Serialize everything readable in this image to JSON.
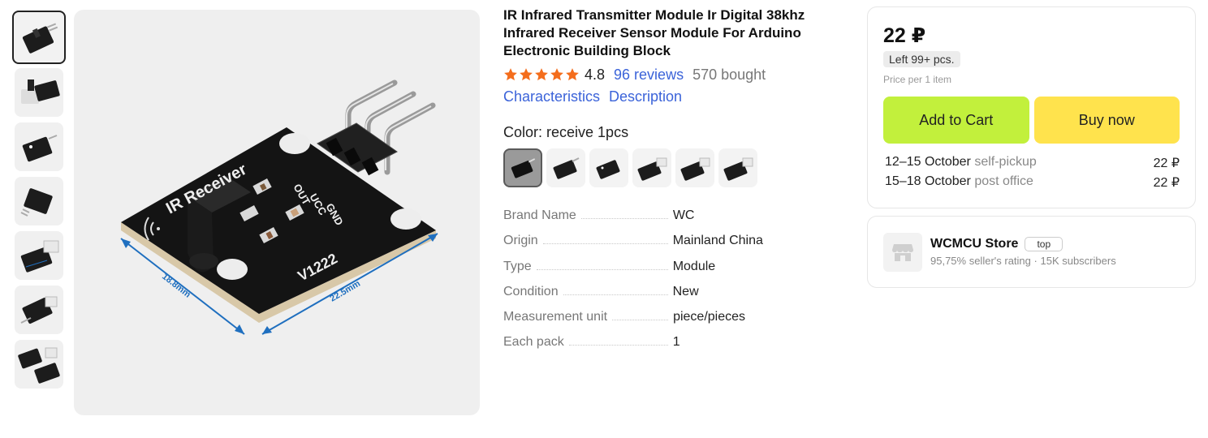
{
  "gallery": {
    "thumbnails": [
      "thumb-1",
      "thumb-2",
      "thumb-3",
      "thumb-4",
      "thumb-5",
      "thumb-6",
      "thumb-7"
    ],
    "selected_index": 0,
    "main_image": {
      "board_labels": [
        "IR Receiver",
        "OUT",
        "UCC",
        "GND",
        "V1222"
      ],
      "dimension_width": "18.8mm",
      "dimension_length": "22.5mm"
    }
  },
  "product": {
    "title": "IR Infrared Transmitter Module Ir Digital 38khz Infrared Receiver Sensor Module For Arduino Electronic Building Block",
    "rating": "4.8",
    "stars": 5,
    "reviews": "96 reviews",
    "bought": "570 bought",
    "links": {
      "characteristics": "Characteristics",
      "description": "Description"
    },
    "color_label": "Color: receive 1pcs",
    "swatch_count": 6,
    "specs": [
      {
        "key": "Brand Name",
        "value": "WC"
      },
      {
        "key": "Origin",
        "value": "Mainland China"
      },
      {
        "key": "Type",
        "value": "Module"
      },
      {
        "key": "Condition",
        "value": "New"
      },
      {
        "key": "Measurement unit",
        "value": "piece/pieces"
      },
      {
        "key": "Each pack",
        "value": "1"
      }
    ]
  },
  "buy_box": {
    "price": "22 ₽",
    "stock": "Left 99+ pcs.",
    "price_note": "Price per 1 item",
    "add_to_cart": "Add to Cart",
    "buy_now": "Buy now",
    "delivery": [
      {
        "date": "12–15 October",
        "method": "self-pickup",
        "price": "22 ₽"
      },
      {
        "date": "15–18 October",
        "method": "post office",
        "price": "22 ₽"
      }
    ]
  },
  "seller": {
    "name": "WCMCU Store",
    "badge": "top",
    "rating": "95,75% seller's rating",
    "separator": "·",
    "subscribers": "15K subscribers"
  },
  "colors": {
    "star": "#f46d1c",
    "link": "#3b63d9",
    "cart_button": "#c2f03c",
    "buy_button": "#ffe34d",
    "dimension_line": "#1f6fbf"
  }
}
